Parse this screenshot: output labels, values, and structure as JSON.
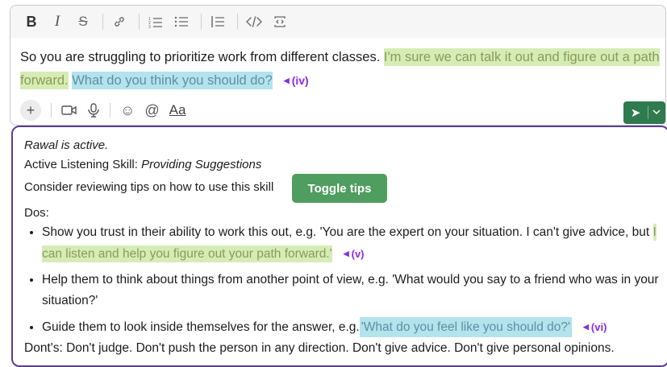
{
  "toolbar": {
    "bold": "B",
    "italic": "I",
    "strike": "S",
    "link": "🔗",
    "ordered_list": "≡",
    "bullet_list": "≡",
    "blockquote": "|≡",
    "code": "</>",
    "code_block": "⎘"
  },
  "message": {
    "text": "So you are struggling to prioritize work from different classes.",
    "hl_green_1": "I'm sure we can talk it out and figure out a path",
    "hl_green_2": "forward.",
    "hl_blue": "What do you think you should do?",
    "marker": "(iv)"
  },
  "actions": {
    "plus": "+",
    "video": "▭",
    "mic": "🎙",
    "emoji": "☺",
    "mention": "@",
    "format": "Aa"
  },
  "send": {
    "arrow": "➤",
    "chevron": "⌄"
  },
  "tips": {
    "status": "Rawal is active.",
    "skill_label": "Active Listening Skill: ",
    "skill_name": "Providing Suggestions",
    "review_text": "Consider reviewing tips on how to use this skill",
    "toggle_label": "Toggle tips",
    "dos_label": "Dos:",
    "do_1_text": "Show you trust in their ability to work this out, e.g. 'You are the expert on your situation. I can't give advice, but",
    "do_1_hl": "I can listen and help you figure out your path forward.'",
    "do_1_marker": "(v)",
    "do_2_text": "Help them to think about things from another point of view, e.g. 'What would you say to a friend who was in your situation?'",
    "do_3_text": "Guide them to look inside themselves for the answer, e.g.",
    "do_3_hl": "'What do you feel like you should do?'",
    "do_3_marker": "(vi)",
    "donts": "Dont's: Don't judge. Don't push the person in any direction. Don't give advice. Don't give personal opinions."
  }
}
